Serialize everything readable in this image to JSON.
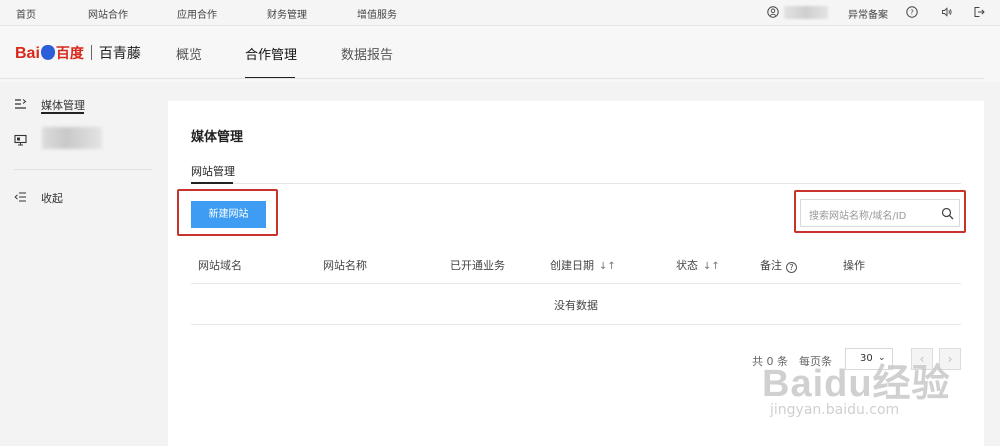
{
  "topbar": {
    "nav": [
      "首页",
      "网站合作",
      "应用合作",
      "财务管理",
      "增值服务"
    ],
    "anomaly_record": "异常备案",
    "icons": [
      "user-icon",
      "help-icon",
      "sound-icon",
      "logout-icon"
    ]
  },
  "header": {
    "logo_bai": "Bai",
    "logo_du": "百度",
    "product": "百青藤",
    "tabs": [
      {
        "label": "概览",
        "active": false
      },
      {
        "label": "合作管理",
        "active": true
      },
      {
        "label": "数据报告",
        "active": false
      }
    ]
  },
  "sidebar": {
    "items": [
      {
        "label": "媒体管理",
        "icon": "list-icon",
        "active": true
      },
      {
        "label": "",
        "icon": "monitor-icon",
        "active": false
      }
    ],
    "collapse_label": "收起"
  },
  "main": {
    "title": "媒体管理",
    "tab": "网站管理",
    "new_button": "新建网站",
    "search_placeholder": "搜索网站名称/域名/ID",
    "columns": [
      "网站域名",
      "网站名称",
      "已开通业务",
      "创建日期",
      "状态",
      "备注",
      "操作"
    ],
    "empty_text": "没有数据",
    "pagination": {
      "total": "共 0 条",
      "per_page_label": "每页条",
      "per_page_value": "30"
    }
  },
  "watermark": {
    "big": "Baidu经验",
    "small": "jingyan.baidu.com"
  },
  "colors": {
    "primary_button": "#3e9df2",
    "highlight_box": "#c8332b",
    "logo_red": "#d9281b",
    "logo_blue": "#2b5ed9"
  }
}
